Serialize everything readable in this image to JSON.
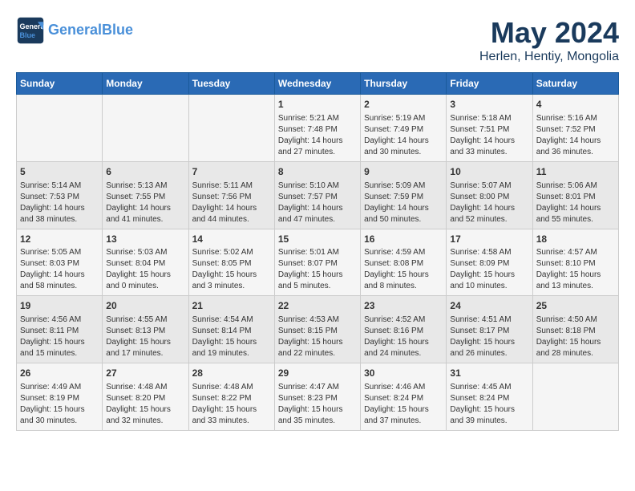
{
  "header": {
    "logo_line1": "General",
    "logo_line2": "Blue",
    "month": "May 2024",
    "location": "Herlen, Hentiy, Mongolia"
  },
  "weekdays": [
    "Sunday",
    "Monday",
    "Tuesday",
    "Wednesday",
    "Thursday",
    "Friday",
    "Saturday"
  ],
  "weeks": [
    [
      {
        "day": "",
        "info": ""
      },
      {
        "day": "",
        "info": ""
      },
      {
        "day": "",
        "info": ""
      },
      {
        "day": "1",
        "info": "Sunrise: 5:21 AM\nSunset: 7:48 PM\nDaylight: 14 hours\nand 27 minutes."
      },
      {
        "day": "2",
        "info": "Sunrise: 5:19 AM\nSunset: 7:49 PM\nDaylight: 14 hours\nand 30 minutes."
      },
      {
        "day": "3",
        "info": "Sunrise: 5:18 AM\nSunset: 7:51 PM\nDaylight: 14 hours\nand 33 minutes."
      },
      {
        "day": "4",
        "info": "Sunrise: 5:16 AM\nSunset: 7:52 PM\nDaylight: 14 hours\nand 36 minutes."
      }
    ],
    [
      {
        "day": "5",
        "info": "Sunrise: 5:14 AM\nSunset: 7:53 PM\nDaylight: 14 hours\nand 38 minutes."
      },
      {
        "day": "6",
        "info": "Sunrise: 5:13 AM\nSunset: 7:55 PM\nDaylight: 14 hours\nand 41 minutes."
      },
      {
        "day": "7",
        "info": "Sunrise: 5:11 AM\nSunset: 7:56 PM\nDaylight: 14 hours\nand 44 minutes."
      },
      {
        "day": "8",
        "info": "Sunrise: 5:10 AM\nSunset: 7:57 PM\nDaylight: 14 hours\nand 47 minutes."
      },
      {
        "day": "9",
        "info": "Sunrise: 5:09 AM\nSunset: 7:59 PM\nDaylight: 14 hours\nand 50 minutes."
      },
      {
        "day": "10",
        "info": "Sunrise: 5:07 AM\nSunset: 8:00 PM\nDaylight: 14 hours\nand 52 minutes."
      },
      {
        "day": "11",
        "info": "Sunrise: 5:06 AM\nSunset: 8:01 PM\nDaylight: 14 hours\nand 55 minutes."
      }
    ],
    [
      {
        "day": "12",
        "info": "Sunrise: 5:05 AM\nSunset: 8:03 PM\nDaylight: 14 hours\nand 58 minutes."
      },
      {
        "day": "13",
        "info": "Sunrise: 5:03 AM\nSunset: 8:04 PM\nDaylight: 15 hours\nand 0 minutes."
      },
      {
        "day": "14",
        "info": "Sunrise: 5:02 AM\nSunset: 8:05 PM\nDaylight: 15 hours\nand 3 minutes."
      },
      {
        "day": "15",
        "info": "Sunrise: 5:01 AM\nSunset: 8:07 PM\nDaylight: 15 hours\nand 5 minutes."
      },
      {
        "day": "16",
        "info": "Sunrise: 4:59 AM\nSunset: 8:08 PM\nDaylight: 15 hours\nand 8 minutes."
      },
      {
        "day": "17",
        "info": "Sunrise: 4:58 AM\nSunset: 8:09 PM\nDaylight: 15 hours\nand 10 minutes."
      },
      {
        "day": "18",
        "info": "Sunrise: 4:57 AM\nSunset: 8:10 PM\nDaylight: 15 hours\nand 13 minutes."
      }
    ],
    [
      {
        "day": "19",
        "info": "Sunrise: 4:56 AM\nSunset: 8:11 PM\nDaylight: 15 hours\nand 15 minutes."
      },
      {
        "day": "20",
        "info": "Sunrise: 4:55 AM\nSunset: 8:13 PM\nDaylight: 15 hours\nand 17 minutes."
      },
      {
        "day": "21",
        "info": "Sunrise: 4:54 AM\nSunset: 8:14 PM\nDaylight: 15 hours\nand 19 minutes."
      },
      {
        "day": "22",
        "info": "Sunrise: 4:53 AM\nSunset: 8:15 PM\nDaylight: 15 hours\nand 22 minutes."
      },
      {
        "day": "23",
        "info": "Sunrise: 4:52 AM\nSunset: 8:16 PM\nDaylight: 15 hours\nand 24 minutes."
      },
      {
        "day": "24",
        "info": "Sunrise: 4:51 AM\nSunset: 8:17 PM\nDaylight: 15 hours\nand 26 minutes."
      },
      {
        "day": "25",
        "info": "Sunrise: 4:50 AM\nSunset: 8:18 PM\nDaylight: 15 hours\nand 28 minutes."
      }
    ],
    [
      {
        "day": "26",
        "info": "Sunrise: 4:49 AM\nSunset: 8:19 PM\nDaylight: 15 hours\nand 30 minutes."
      },
      {
        "day": "27",
        "info": "Sunrise: 4:48 AM\nSunset: 8:20 PM\nDaylight: 15 hours\nand 32 minutes."
      },
      {
        "day": "28",
        "info": "Sunrise: 4:48 AM\nSunset: 8:22 PM\nDaylight: 15 hours\nand 33 minutes."
      },
      {
        "day": "29",
        "info": "Sunrise: 4:47 AM\nSunset: 8:23 PM\nDaylight: 15 hours\nand 35 minutes."
      },
      {
        "day": "30",
        "info": "Sunrise: 4:46 AM\nSunset: 8:24 PM\nDaylight: 15 hours\nand 37 minutes."
      },
      {
        "day": "31",
        "info": "Sunrise: 4:45 AM\nSunset: 8:24 PM\nDaylight: 15 hours\nand 39 minutes."
      },
      {
        "day": "",
        "info": ""
      }
    ]
  ]
}
